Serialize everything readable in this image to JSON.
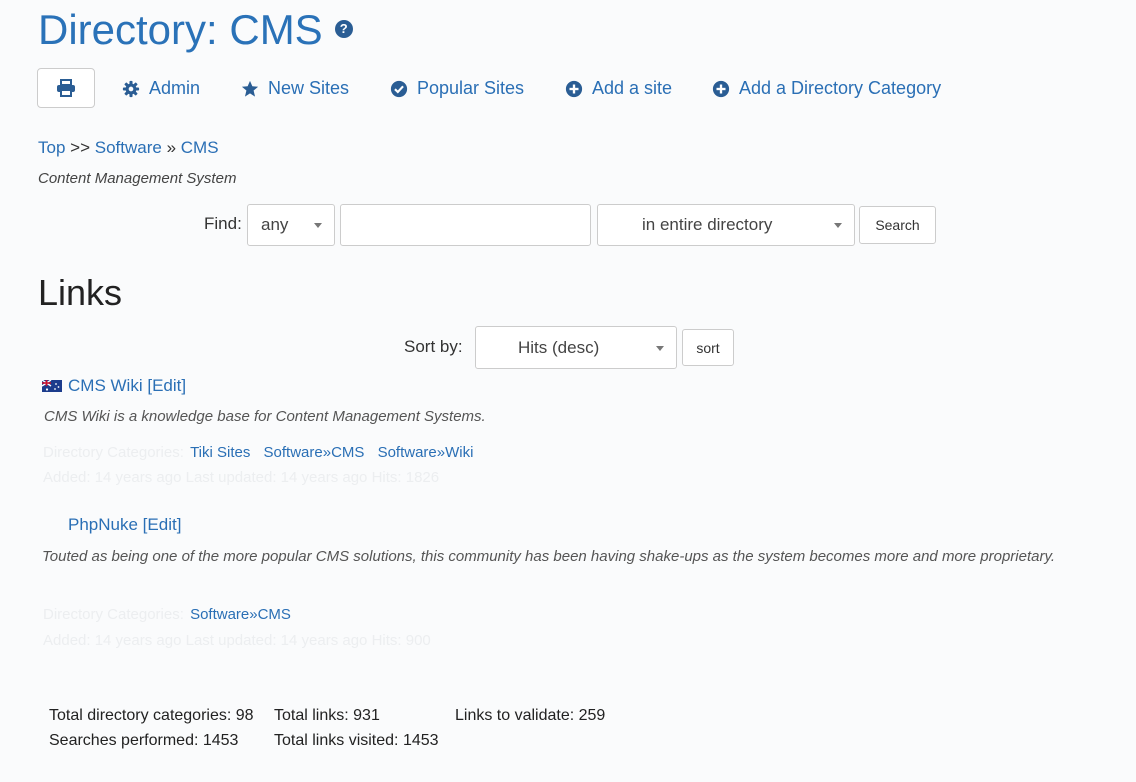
{
  "page": {
    "title": "Directory: CMS",
    "help_glyph": "?"
  },
  "toolbar": {
    "print_icon": "print-icon",
    "items": [
      {
        "label": "Admin",
        "icon": "gear-icon"
      },
      {
        "label": "New Sites",
        "icon": "star-icon"
      },
      {
        "label": "Popular Sites",
        "icon": "check-circle-icon"
      },
      {
        "label": "Add a site",
        "icon": "plus-circle-icon"
      },
      {
        "label": "Add a Directory Category",
        "icon": "plus-circle-icon"
      }
    ]
  },
  "breadcrumb": {
    "top": "Top",
    "sep1": ">>",
    "software": "Software",
    "sep2": "»",
    "cms": "CMS"
  },
  "category_description": "Content Management System",
  "search": {
    "find_label": "Find:",
    "mode_value": "any",
    "query_value": "",
    "scope_value": "in entire directory",
    "button_label": "Search"
  },
  "links_heading": "Links",
  "sort": {
    "label": "Sort by:",
    "value": "Hits (desc)",
    "button_label": "sort"
  },
  "entries": [
    {
      "title": "CMS Wiki",
      "edit_label": "[Edit]",
      "description": "CMS Wiki is a knowledge base for Content Management Systems.",
      "categories_label": "Directory Categories:",
      "categories": [
        "Tiki Sites",
        "Software»CMS",
        "Software»Wiki"
      ],
      "meta": "Added: 14 years ago Last updated: 14 years ago Hits: 1826"
    },
    {
      "title": "PhpNuke",
      "edit_label": "[Edit]",
      "description": "Touted as being one of the more popular CMS solutions, this community has been having shake-ups as the system becomes more and more proprietary.",
      "categories_label": "Directory Categories:",
      "categories": [
        "Software»CMS"
      ],
      "meta": "Added: 14 years ago Last updated: 14 years ago Hits: 900"
    }
  ],
  "stats": {
    "total_categories": "Total directory categories: 98",
    "total_links": "Total links: 931",
    "to_validate": "Links to validate: 259",
    "searches": "Searches performed: 1453",
    "visited": "Total links visited: 1453"
  },
  "colors": {
    "link": "#2a6fb5",
    "title": "#2a72b8"
  }
}
